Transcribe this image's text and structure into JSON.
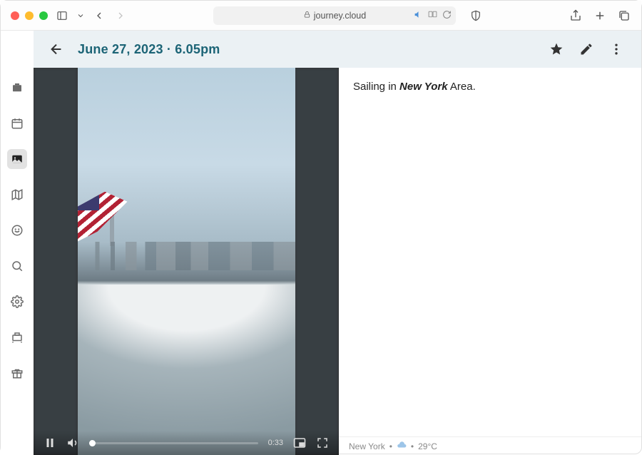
{
  "browser": {
    "url_host": "journey.cloud"
  },
  "header": {
    "title": "June 27, 2023 · 6.05pm"
  },
  "entry": {
    "text_prefix": "Sailing in ",
    "text_bold": "New York",
    "text_suffix": " Area."
  },
  "video": {
    "time": "0:33"
  },
  "status": {
    "location": "New York",
    "sep1": "•",
    "weather_icon": "cloud",
    "sep2": "•",
    "temperature": "29°C"
  }
}
